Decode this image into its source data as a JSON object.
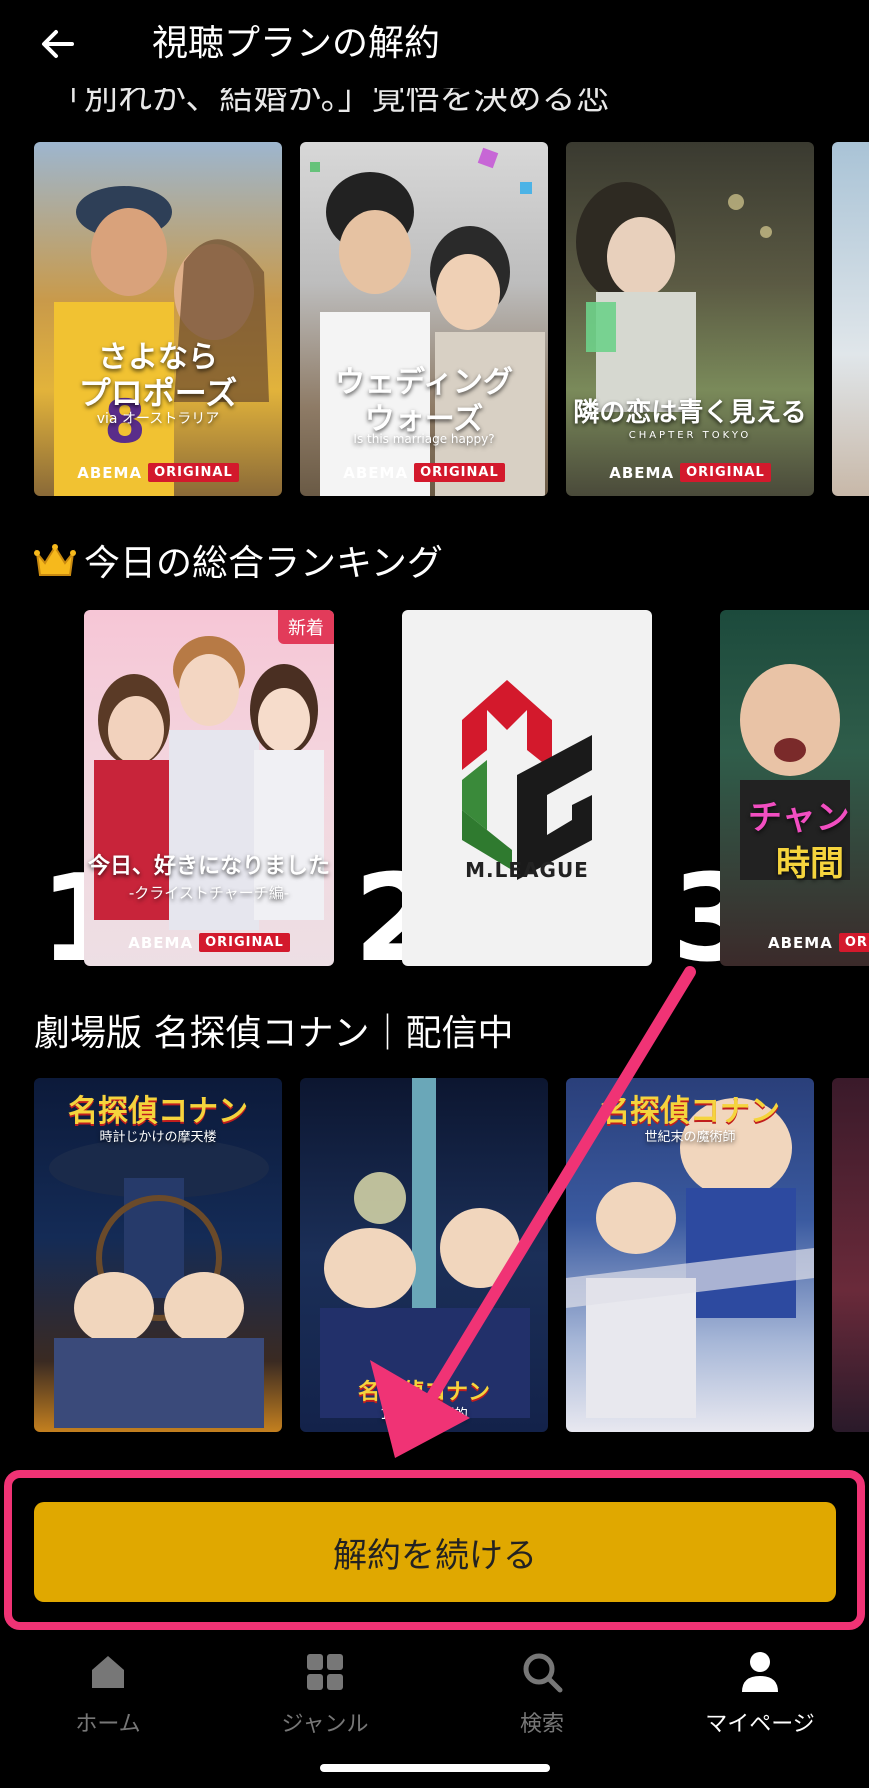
{
  "header": {
    "title": "視聴プランの解約",
    "partial_heading": "「別れか、結婚か。」覚悟を決める恋"
  },
  "row1": {
    "cards": [
      {
        "title_line1": "さよなら",
        "title_line2": "プロポーズ",
        "subtitle": "via オーストラリア",
        "brand": "ABEMA",
        "tag": "ORIGINAL"
      },
      {
        "title_line1": "ウェディング",
        "title_line2": "ウォーズ",
        "subtitle": "Is this marriage happy?",
        "brand": "ABEMA",
        "tag": "ORIGINAL"
      },
      {
        "title_line1": "隣の恋は青く見える",
        "title_line2": "",
        "subtitle": "CHAPTER TOKYO",
        "brand": "ABEMA",
        "tag": "ORIGINAL"
      }
    ]
  },
  "ranking": {
    "title": "今日の総合ランキング",
    "crown_icon": "crown-icon",
    "items": [
      {
        "rank": "1",
        "title": "今日、好きになりました",
        "subtitle": "-クライストチャーチ編-",
        "badge": "新着",
        "brand": "ABEMA",
        "tag": "ORIGINAL"
      },
      {
        "rank": "2",
        "title": "M.LEAGUE"
      },
      {
        "rank": "3",
        "title_line1": "チャン",
        "title_line2": "時間",
        "brand": "ABEMA",
        "tag": "ORIGINAL"
      }
    ]
  },
  "conan": {
    "title": "劇場版 名探偵コナン｜配信中",
    "items": [
      {
        "title": "名探偵コナン",
        "subtitle": "時計じかけの摩天楼"
      },
      {
        "title": "名探偵コナン",
        "subtitle": "14番目の標的"
      },
      {
        "title": "名探偵コナン",
        "subtitle": "世紀末の魔術師"
      }
    ]
  },
  "cta": {
    "label": "解約を続ける"
  },
  "nav": {
    "items": [
      {
        "label": "ホーム",
        "icon": "home-icon"
      },
      {
        "label": "ジャンル",
        "icon": "grid-icon"
      },
      {
        "label": "検索",
        "icon": "search-icon"
      },
      {
        "label": "マイページ",
        "icon": "person-icon"
      }
    ]
  },
  "colors": {
    "accent": "#e0a800",
    "highlight": "#f03375",
    "original_tag": "#d3192c"
  }
}
